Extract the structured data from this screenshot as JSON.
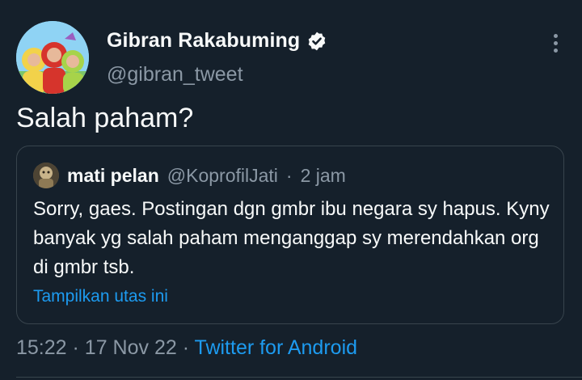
{
  "tweet": {
    "author_name": "Gibran Rakabuming",
    "handle": "@gibran_tweet",
    "text": "Salah paham?",
    "time": "15:22",
    "separator": "·",
    "date": "17 Nov 22",
    "source": "Twitter for Android"
  },
  "quoted": {
    "name": "mati pelan",
    "handle": "@KoprofilJati",
    "separator": "·",
    "time": "2 jam",
    "text": "Sorry, gaes. Postingan dgn gmbr ibu negara sy hapus. Kyny banyak yg salah paham menganggap sy merendahkan org di gmbr tsb.",
    "thread_link": "Tampilkan utas ini"
  },
  "icons": {
    "verified": "verified-badge-icon",
    "more": "more-vertical-icon"
  },
  "colors": {
    "background": "#15202b",
    "text": "#f7f9f9",
    "secondary": "#8b98a5",
    "link": "#1d9bf0",
    "border": "#38444d"
  }
}
